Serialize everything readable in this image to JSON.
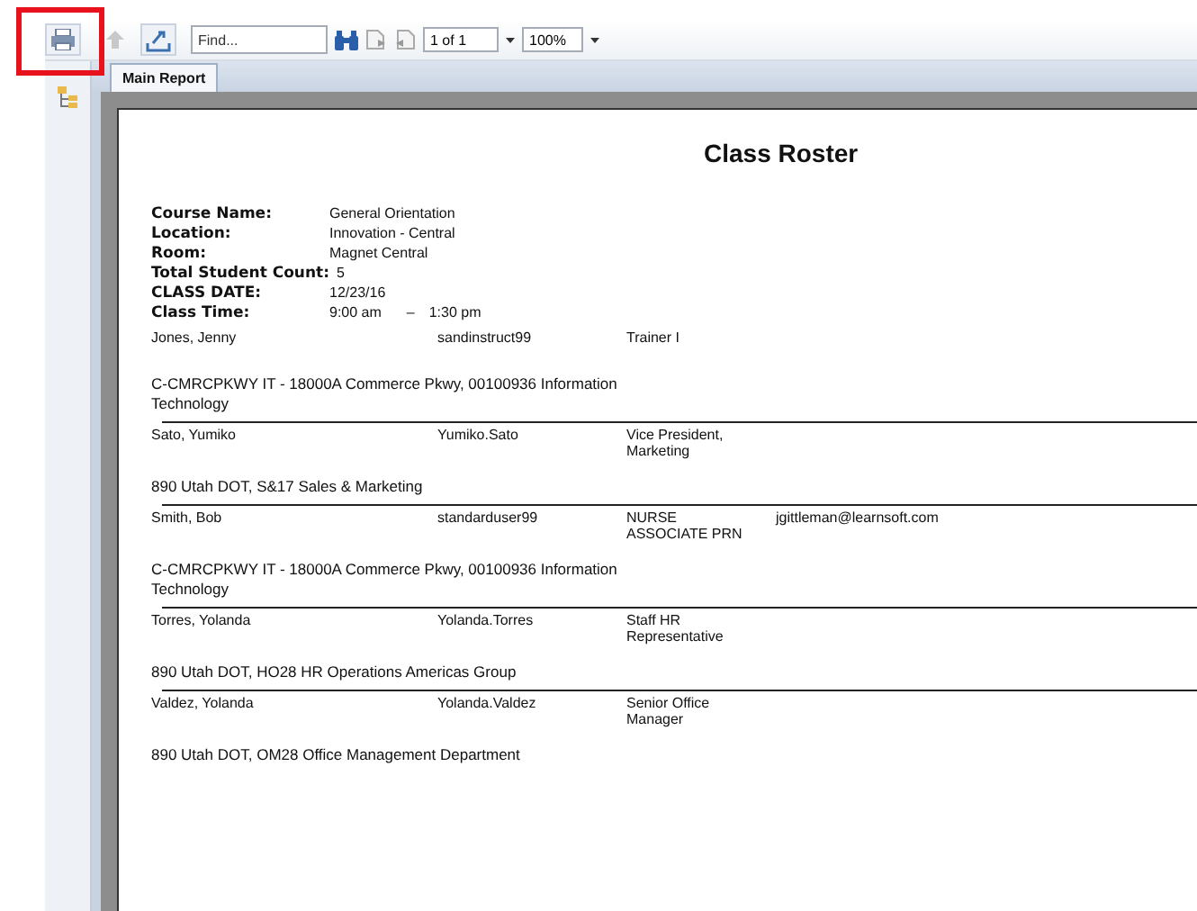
{
  "toolbar": {
    "buttons": [
      {
        "kind": "print",
        "disabled": false,
        "highlighted": true
      },
      {
        "kind": "up",
        "disabled": true,
        "highlighted": false
      },
      {
        "kind": "export",
        "disabled": false,
        "highlighted": false
      }
    ],
    "find": {
      "placeholder": "Find..."
    },
    "page_select": {
      "value": "1 of 1"
    },
    "zoom_select": {
      "value": "100%"
    }
  },
  "tabs": [
    {
      "label": "Main Report",
      "selected": true
    }
  ],
  "report": {
    "title": "Class Roster",
    "fields": [
      {
        "label": "Course Name:",
        "value": "General Orientation"
      },
      {
        "label": "Location:",
        "value": "Innovation -  Central"
      },
      {
        "label": "Room:",
        "value": "Magnet Central"
      },
      {
        "label": "Total Student Count:",
        "value": "5"
      },
      {
        "label": "CLASS DATE:",
        "value": "12/23/16"
      },
      {
        "label": "Class Time:",
        "value": "9:00 am",
        "value_end": "1:30 pm",
        "separator": "–"
      }
    ],
    "students": [
      {
        "name": "Jones, Jenny",
        "username": "sandinstruct99",
        "title": "Trainer I",
        "department": "C-CMRCPKWY IT - 18000A Commerce Pkwy, 00100936 Information Technology"
      },
      {
        "name": "Sato, Yumiko",
        "username": "Yumiko.Sato",
        "title": "Vice President, Marketing",
        "department": "890 Utah DOT, S&17 Sales & Marketing"
      },
      {
        "name": "Smith, Bob",
        "username": "standarduser99",
        "title": "NURSE ASSOCIATE PRN",
        "email": "jgittleman@learnsoft.com",
        "department": "C-CMRCPKWY IT - 18000A Commerce Pkwy, 00100936 Information Technology"
      },
      {
        "name": "Torres, Yolanda",
        "username": "Yolanda.Torres",
        "title": "Staff HR Representative",
        "department": "890 Utah DOT, HO28 HR Operations Americas Group"
      },
      {
        "name": "Valdez, Yolanda",
        "username": "Yolanda.Valdez",
        "title": "Senior Office Manager",
        "department": "890 Utah DOT, OM28 Office Management Department"
      }
    ]
  }
}
